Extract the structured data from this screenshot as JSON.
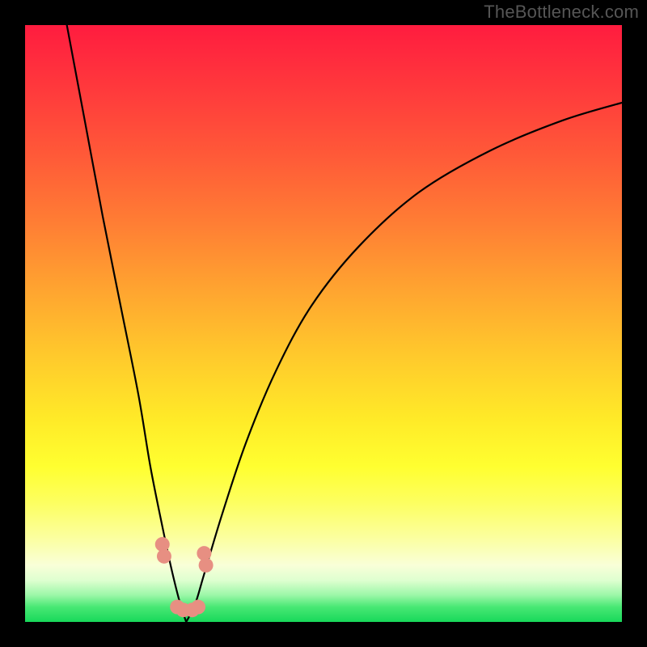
{
  "watermark": "TheBottleneck.com",
  "chart_data": {
    "type": "line",
    "title": "",
    "xlabel": "",
    "ylabel": "",
    "xlim": [
      0,
      100
    ],
    "ylim": [
      0,
      100
    ],
    "description": "Bottleneck curve over a red-yellow-green vertical gradient. Two curved black branches descend from top-left and top-right towards a narrow minimum near x≈27. A thin green band at the very bottom indicates the optimal (bottleneck-free) region. Small salmon-colored markers sit on the curve near the minimum.",
    "gradient_stops": [
      {
        "offset": 0.0,
        "color": "#ff1c3f"
      },
      {
        "offset": 0.11,
        "color": "#ff3a3c"
      },
      {
        "offset": 0.22,
        "color": "#ff5a38"
      },
      {
        "offset": 0.33,
        "color": "#ff7d34"
      },
      {
        "offset": 0.44,
        "color": "#ffa330"
      },
      {
        "offset": 0.55,
        "color": "#ffc82c"
      },
      {
        "offset": 0.66,
        "color": "#ffea28"
      },
      {
        "offset": 0.74,
        "color": "#ffff30"
      },
      {
        "offset": 0.8,
        "color": "#fdff60"
      },
      {
        "offset": 0.86,
        "color": "#fbffa0"
      },
      {
        "offset": 0.905,
        "color": "#f9ffd8"
      },
      {
        "offset": 0.93,
        "color": "#dfffd0"
      },
      {
        "offset": 0.955,
        "color": "#9cf7a8"
      },
      {
        "offset": 0.975,
        "color": "#48e874"
      },
      {
        "offset": 1.0,
        "color": "#18d85a"
      }
    ],
    "series": [
      {
        "name": "left-branch",
        "x": [
          7,
          10,
          13,
          16,
          19,
          21,
          23,
          24.5,
          26,
          27
        ],
        "y": [
          100,
          84,
          68,
          53,
          38,
          26,
          16,
          9,
          3,
          0
        ]
      },
      {
        "name": "right-branch",
        "x": [
          27,
          28.5,
          30,
          33,
          37,
          42,
          48,
          56,
          66,
          78,
          90,
          100
        ],
        "y": [
          0,
          3,
          8,
          18,
          30,
          42,
          53,
          63,
          72,
          79,
          84,
          87
        ]
      }
    ],
    "markers": [
      {
        "x": 23.0,
        "y": 13.0
      },
      {
        "x": 23.3,
        "y": 11.0
      },
      {
        "x": 30.0,
        "y": 11.5
      },
      {
        "x": 30.3,
        "y": 9.5
      },
      {
        "x": 25.5,
        "y": 2.5
      },
      {
        "x": 26.5,
        "y": 2.0
      },
      {
        "x": 28.0,
        "y": 2.0
      },
      {
        "x": 29.0,
        "y": 2.5
      }
    ],
    "marker_color": "#e78f82",
    "curve_color": "#000000",
    "curve_width": 2.2
  }
}
